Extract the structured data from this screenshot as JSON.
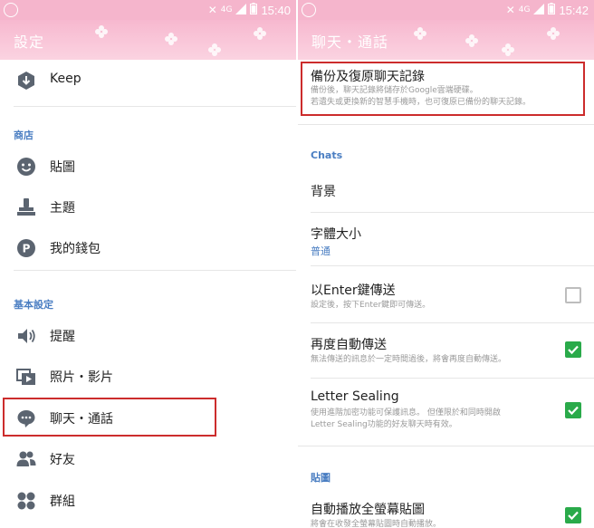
{
  "left": {
    "status": {
      "time": "15:40"
    },
    "header_title": "設定",
    "top_item": {
      "label": "Keep",
      "icon": "keep-icon"
    },
    "sections": [
      {
        "title": "商店",
        "items": [
          {
            "label": "貼圖",
            "icon": "sticker-icon"
          },
          {
            "label": "主題",
            "icon": "theme-icon"
          },
          {
            "label": "我的錢包",
            "icon": "wallet-icon"
          }
        ]
      },
      {
        "title": "基本設定",
        "items": [
          {
            "label": "提醒",
            "icon": "speaker-icon"
          },
          {
            "label": "照片・影片",
            "icon": "photo-video-icon"
          },
          {
            "label": "聊天・通話",
            "icon": "chat-icon"
          },
          {
            "label": "好友",
            "icon": "friends-icon"
          },
          {
            "label": "群組",
            "icon": "groups-icon"
          }
        ]
      }
    ]
  },
  "right": {
    "status": {
      "time": "15:42"
    },
    "header_title": "聊天・通話",
    "backup": {
      "title": "備份及復原聊天記錄",
      "desc_line1": "備份後，聊天記錄將儲存於Google雲端硬碟。",
      "desc_line2": "若遺失或更換新的智慧手機時，也可復原已備份的聊天記錄。"
    },
    "chats_section": "Chats",
    "background_label": "背景",
    "font_size": {
      "title": "字體大小",
      "value": "普通"
    },
    "enter_send": {
      "title": "以Enter鍵傳送",
      "desc": "設定後，按下Enter鍵即可傳送。",
      "checked": false
    },
    "auto_resend": {
      "title": "再度自動傳送",
      "desc": "無法傳送的訊息於一定時間過後，將會再度自動傳送。",
      "checked": true
    },
    "letter_sealing": {
      "title": "Letter Sealing",
      "desc_line1": "使用進階加密功能可保護訊息。 但僅限於和同時開啟",
      "desc_line2": "Letter Sealing功能的好友聊天時有效。",
      "checked": true
    },
    "stickers_section": "貼圖",
    "autoplay": {
      "title": "自動播放全螢幕貼圖",
      "desc": "將會在收發全螢幕貼圖時自動播放。",
      "checked": true
    }
  },
  "colors": {
    "header_pink": "#f7b8cf",
    "section_blue": "#4a7ec2",
    "checkbox_green": "#2aaa4a",
    "highlight_red": "#cc2c2c"
  }
}
